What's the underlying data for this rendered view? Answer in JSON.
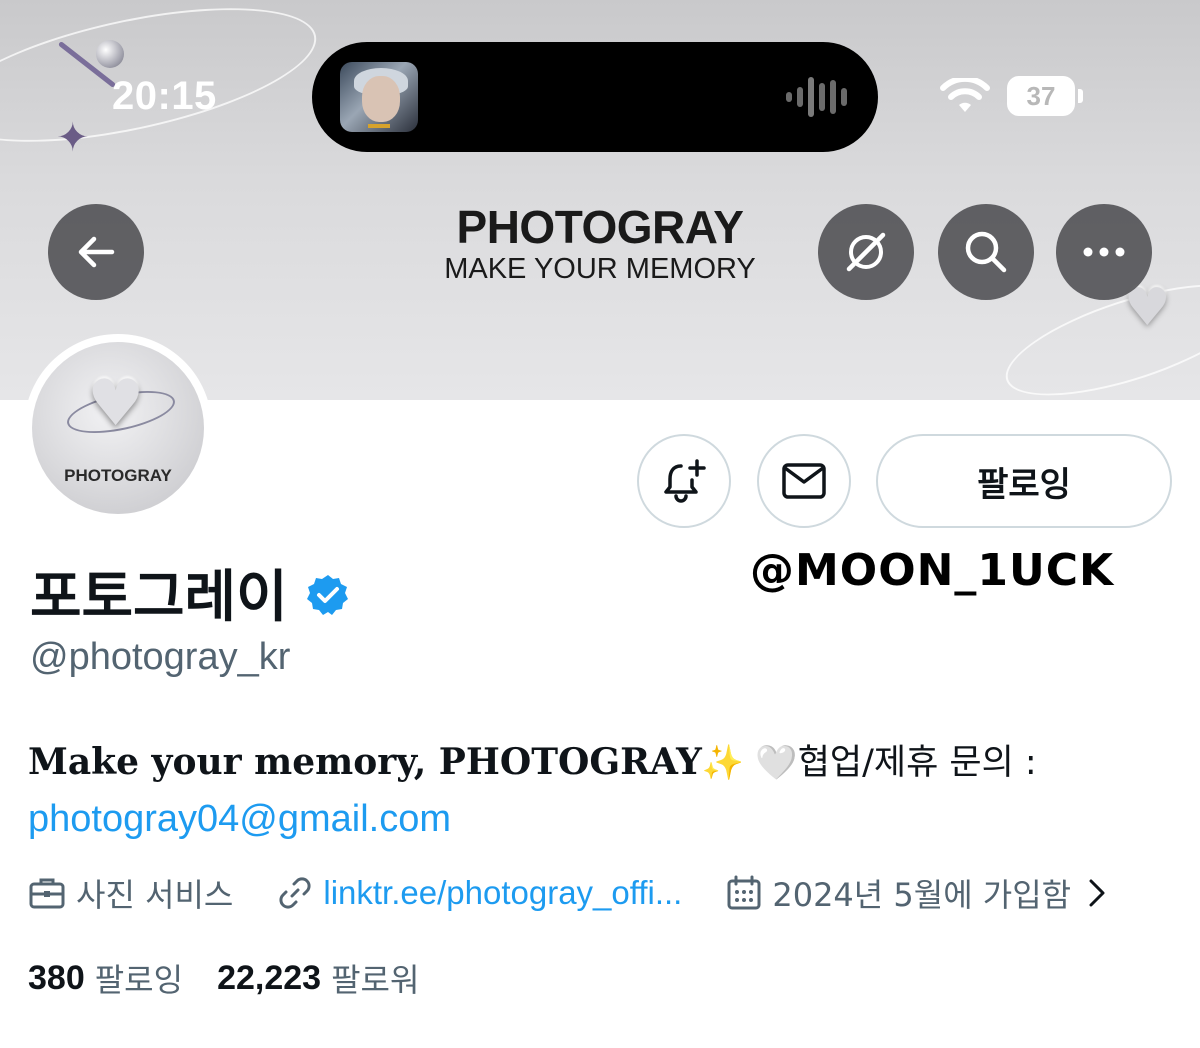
{
  "status_bar": {
    "time": "20:15",
    "battery": "37"
  },
  "header": {
    "brand_name": "PHOTOGRAY",
    "brand_tagline": "MAKE YOUR MEMORY"
  },
  "avatar": {
    "label": "PHOTOGRAY"
  },
  "actions": {
    "follow_label": "팔로잉"
  },
  "watermark": "@MOON_1UCK",
  "profile": {
    "display_name": "포토그레이",
    "handle": "@photogray_kr",
    "bio_part1": "Make your memory, PHOTOGRAY",
    "bio_emoji1": "✨",
    "bio_emoji2": "🤍",
    "bio_part2": "협업/제휴 문의 :",
    "bio_email": "photogray04@gmail.com",
    "category": "사진 서비스",
    "website": "linktr.ee/photogray_offi...",
    "joined": "2024년 5월에 가입함"
  },
  "stats": {
    "following_count": "380",
    "following_label": "팔로잉",
    "followers_count": "22,223",
    "followers_label": "팔로워"
  },
  "colors": {
    "link": "#1d9bf0",
    "secondary_text": "#536471",
    "verified": "#1d9bf0"
  }
}
